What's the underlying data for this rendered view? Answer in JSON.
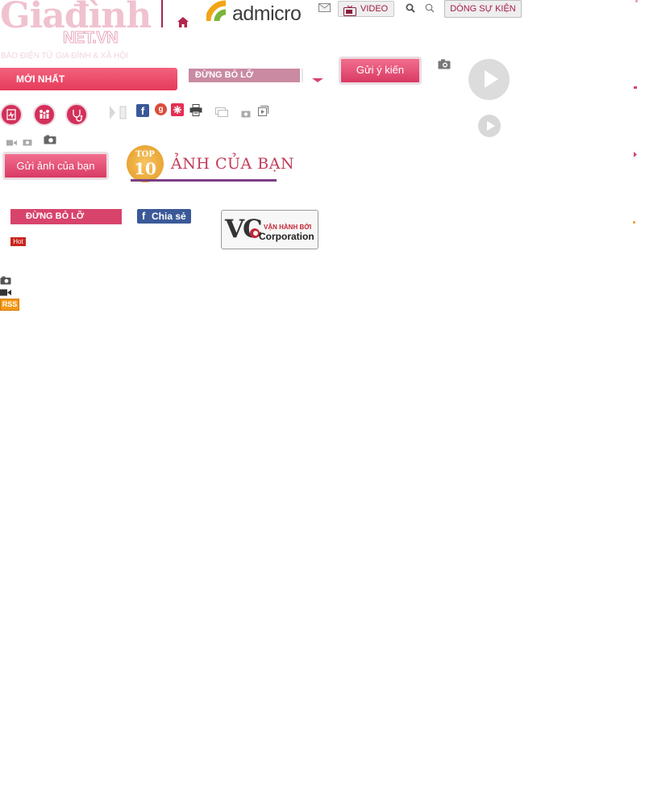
{
  "header": {
    "logo_main": "Giađình",
    "logo_sub": "NET.VN",
    "tagline": "BÁO ĐIỆN TỬ GIA ĐÌNH & XÃ HỘI",
    "admicro_label": "admicro",
    "video_label": "VIDEO",
    "events_label": "DÒNG SỰ KIỆN"
  },
  "nav": {
    "latest_label": "MỚI NHẤT",
    "dont_miss_label": "ĐỪNG BỎ LỠ",
    "feedback_button": "Gửi ý kiến"
  },
  "share": {
    "google_plus_glyph": "g",
    "facebook_glyph": "f"
  },
  "photos": {
    "send_photo_button": "Gửi ảnh của bạn",
    "top_badge_line1": "TOP",
    "top_badge_line2": "10",
    "your_photos_title": "ẢNH CỦA BẠN"
  },
  "footer_block": {
    "dont_miss_label": "ĐỪNG BỎ LỠ",
    "share_button": "Chia sẻ",
    "hot_badge": "Hot",
    "operated_by": "VẬN HÀNH BỞI",
    "corporation": "Corporation",
    "vcc_mark": "VC",
    "rss_label": "RSS"
  },
  "colors": {
    "brand_pink": "#e63a5c",
    "brand_maroon": "#9c2a4b",
    "facebook_blue": "#3b5998"
  }
}
